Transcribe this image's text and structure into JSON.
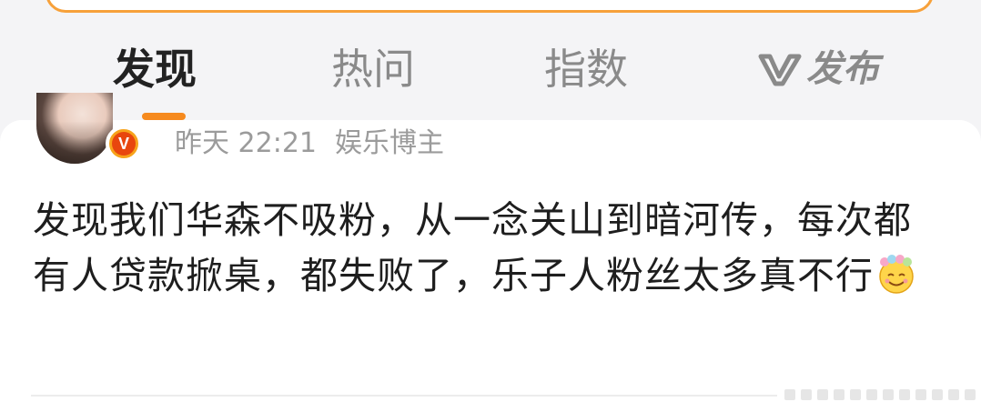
{
  "tabs": [
    {
      "label": "发现",
      "active": true
    },
    {
      "label": "热问",
      "active": false
    },
    {
      "label": "指数",
      "active": false
    },
    {
      "label": "发布",
      "active": false
    }
  ],
  "colors": {
    "accent": "#f68a1e",
    "search_border": "#f7a13a",
    "verified_badge": "#e8460e",
    "text_primary": "#1e1e1e",
    "text_secondary": "#9b9b9b"
  },
  "post": {
    "verified_mark": "V",
    "time": "昨天 22:21",
    "author_type": "娱乐博主",
    "text": "发现我们华森不吸粉，从一念关山到暗河传，每次都有人贷款掀桌，都失败了，乐子人粉丝太多真不行",
    "emoji": "smiling-flower-emoji"
  },
  "icons": {
    "publish_logo": "v-logo-icon",
    "avatar": "avatar",
    "verified": "verified-badge-icon"
  }
}
